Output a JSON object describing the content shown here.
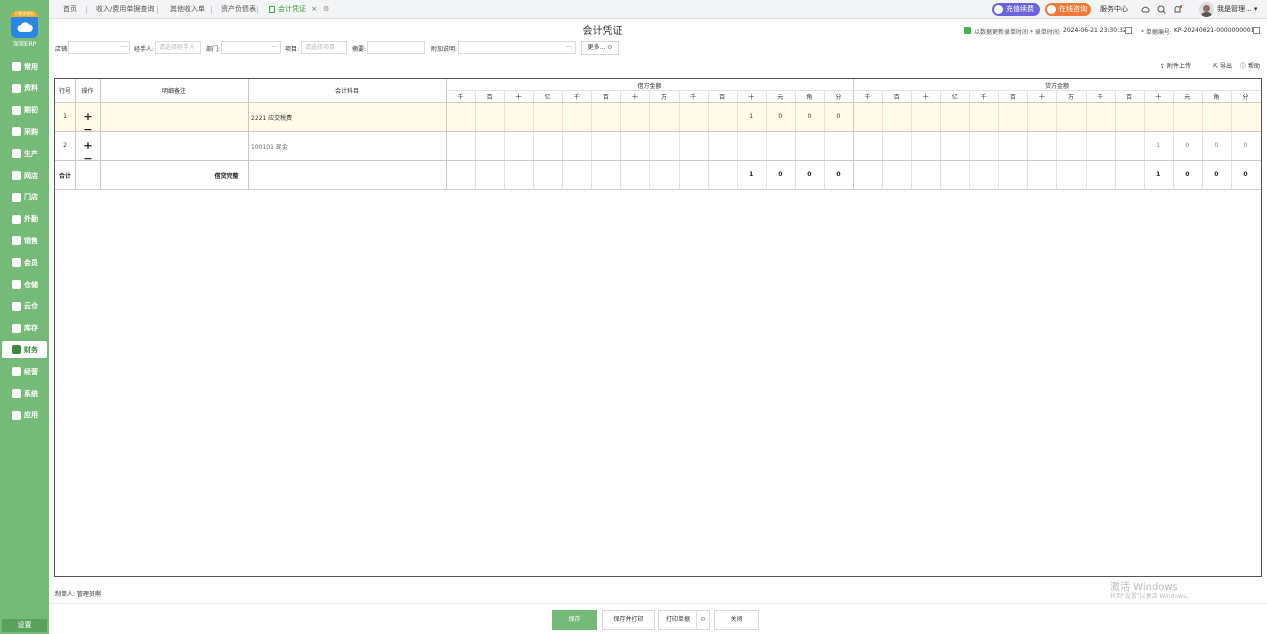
{
  "sidebar": {
    "logo_tag": "万能进销存",
    "brand": "深圳ERP",
    "items": [
      "常用",
      "资料",
      "期初",
      "采购",
      "生产",
      "网店",
      "门店",
      "外勤",
      "销售",
      "会员",
      "仓储",
      "云仓",
      "库存",
      "财务",
      "经营",
      "系统",
      "应用"
    ],
    "active": "财务",
    "settings": "设置"
  },
  "tabs": [
    "首页",
    "收入/费用单据查询",
    "其他收入单",
    "资产负债表",
    "会计凭证"
  ],
  "active_tab": "会计凭证",
  "topbar": {
    "renew": "充值续费",
    "online": "在线咨询",
    "service": "服务中心",
    "user": "我是管理..."
  },
  "page": {
    "title": "会计凭证",
    "auto_update_label": "以数据更新录单时间",
    "date_label": "* 录单时间:",
    "date_value": "2024-06-21 23:30:32",
    "number_label": "* 单据编号:",
    "number_value": "KP-20240621-0000000001"
  },
  "filters": {
    "store_label": "店铺:",
    "handler_label": "经手人:",
    "handler_placeholder": "请选择经手人",
    "dept_label": "部门:",
    "project_label": "项目:",
    "project_placeholder": "请选择项目",
    "summary_label": "摘要:",
    "extra_label": "附加说明:",
    "more": "更多..."
  },
  "actions": {
    "upload": "附件上传",
    "export": "导出",
    "help": "帮助"
  },
  "table": {
    "headers": {
      "row": "行号",
      "op": "操作",
      "note": "明细备注",
      "subject": "会计科目",
      "debit": "借方金额",
      "credit": "贷方金额"
    },
    "digits": [
      "千",
      "百",
      "十",
      "亿",
      "千",
      "百",
      "十",
      "万",
      "千",
      "百",
      "十",
      "元",
      "角",
      "分"
    ],
    "rows": [
      {
        "no": "1",
        "subject": "2221 应交税费",
        "debit": [
          "1",
          "0",
          "0",
          "0"
        ],
        "credit": [
          "",
          "",
          "",
          ""
        ]
      },
      {
        "no": "2",
        "subject": "100101 现金",
        "debit": [
          "",
          "",
          "",
          ""
        ],
        "credit": [
          "1",
          "0",
          "0",
          "0"
        ]
      }
    ],
    "total": {
      "label": "合计",
      "balance": "借贷完整",
      "debit": [
        "1",
        "0",
        "0",
        "0"
      ],
      "credit": [
        "1",
        "0",
        "0",
        "0"
      ]
    }
  },
  "footer": {
    "maker": "制单人: 管理员啊",
    "save": "保存",
    "save_print": "保存并打印",
    "print": "打印单据",
    "close": "关闭"
  },
  "watermark": {
    "line1": "激活 Windows",
    "line2": "转到\"设置\"以激活 Windows。"
  },
  "colors": {
    "sidebar": "#76ba7a",
    "accent": "#3a9a3f",
    "renew": "#6b63d9",
    "online": "#f07a3a",
    "highlight_row": "#fffbe8"
  }
}
